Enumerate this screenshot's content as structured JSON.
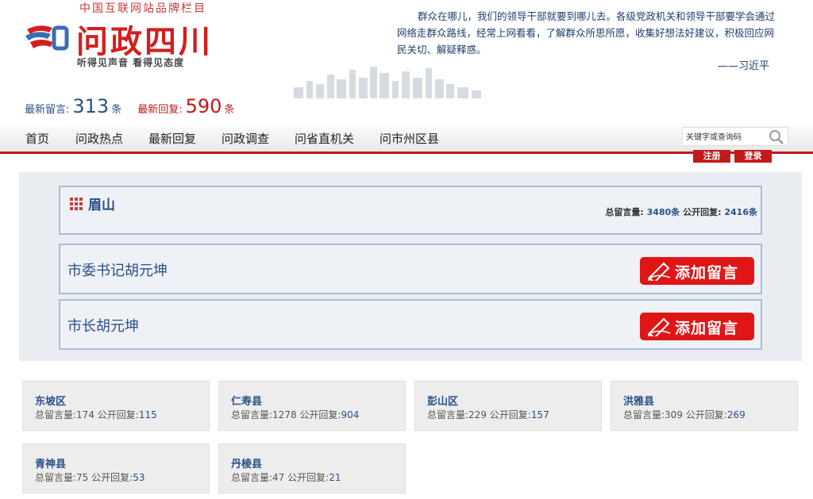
{
  "header": {
    "tagline": "中国互联网站品牌栏目",
    "logo_title": "问政四川",
    "logo_slogan": "听得见声音  看得见态度",
    "quote": "群众在哪儿，我们的领导干部就要到哪儿去。各级党政机关和领导干部要学会通过网络走群众路线，经常上网看看，了解群众所思所愿，收集好想法好建议，积极回应网民关切、解疑释惑。",
    "quote_author": "——习近平",
    "latest_msg_label": "最新留言:",
    "latest_msg_count": "313",
    "latest_msg_unit": "条",
    "latest_reply_label": "最新回复:",
    "latest_reply_count": "590",
    "latest_reply_unit": "条"
  },
  "nav": {
    "items": [
      "首页",
      "问政热点",
      "最新回复",
      "问政调查",
      "问省直机关",
      "问市州区县"
    ],
    "search_placeholder": "关键字或查询码",
    "register": "注册",
    "login": "登录"
  },
  "city": {
    "name": "眉山",
    "total_label": "总留言量:",
    "total_value": "3480条",
    "reply_label": "公开回复:",
    "reply_value": "2416条"
  },
  "leaders": [
    {
      "title": "市委书记胡元坤",
      "button": "添加留言"
    },
    {
      "title": "市长胡元坤",
      "button": "添加留言"
    }
  ],
  "counties": [
    {
      "name": "东坡区",
      "total_label": "总留言量:",
      "total": "174",
      "reply_label": "公开回复:",
      "reply": "115"
    },
    {
      "name": "仁寿县",
      "total_label": "总留言量:",
      "total": "1278",
      "reply_label": "公开回复:",
      "reply": "904"
    },
    {
      "name": "彭山区",
      "total_label": "总留言量:",
      "total": "229",
      "reply_label": "公开回复:",
      "reply": "157"
    },
    {
      "name": "洪雅县",
      "total_label": "总留言量:",
      "total": "309",
      "reply_label": "公开回复:",
      "reply": "269"
    },
    {
      "name": "青神县",
      "total_label": "总留言量:",
      "total": "75",
      "reply_label": "公开回复:",
      "reply": "53"
    },
    {
      "name": "丹棱县",
      "total_label": "总留言量:",
      "total": "47",
      "reply_label": "公开回复:",
      "reply": "21"
    }
  ],
  "colors": {
    "brand_red": "#c21919",
    "brand_blue": "#2a4f8a",
    "panel_bg": "#e9edf1",
    "card_bg": "#ededed"
  },
  "icons": {
    "logo": "wenzheng-logo-icon",
    "search": "search-icon",
    "city": "grid-icon",
    "add": "pencil-icon"
  }
}
